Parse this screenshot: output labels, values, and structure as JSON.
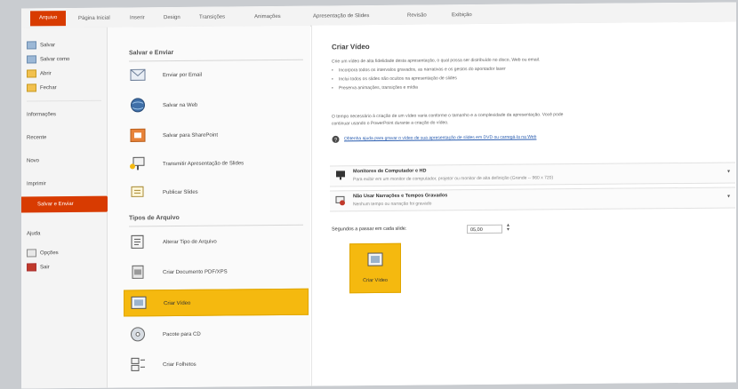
{
  "ribbon": {
    "tabs": [
      "Arquivo",
      "Página Inicial",
      "Inserir",
      "Design",
      "Transições",
      "Animações",
      "Apresentação de Slides",
      "Revisão",
      "Exibição"
    ]
  },
  "leftnav": {
    "items_top": [
      "Salvar",
      "Salvar como",
      "Abrir",
      "Fechar"
    ],
    "items_mid": [
      "Informações",
      "Recente",
      "Novo",
      "Imprimir"
    ],
    "active": "Salvar e Enviar",
    "items_bottom": [
      "Ajuda",
      "Opções",
      "Sair"
    ]
  },
  "middle": {
    "section1": "Salvar e Enviar",
    "send_items": [
      "Enviar por Email",
      "Salvar na Web",
      "Salvar para SharePoint",
      "Transmitir Apresentação de Slides",
      "Publicar Slides"
    ],
    "section2": "Tipos de Arquivo",
    "file_items": [
      "Alterar Tipo de Arquivo",
      "Criar Documento PDF/XPS",
      "Criar Vídeo",
      "Pacote para CD",
      "Criar Folhetos"
    ]
  },
  "right": {
    "title": "Criar Vídeo",
    "intro": "Crie um vídeo de alta fidelidade desta apresentação, o qual possa ser distribuído no disco, Web ou email.",
    "bullets": [
      "Incorpora todos os intervalos gravados, as narrativas e os gestos do apontador laser",
      "Inclui todos os slides não ocultos na apresentação de slides",
      "Preserva animações, transições e mídia"
    ],
    "time_note_1": "O tempo necessário à criação de um vídeo varia conforme o tamanho e a complexidade da apresentação. Você pode",
    "time_note_2": "continuar usando o PowerPoint durante a criação do vídeo.",
    "help_link": "Obtenha ajuda para gravar o vídeo de sua apresentação de slides em DVD ou carregá-la na Web",
    "quality_title": "Monitores de Computador e HD",
    "quality_desc": "Para exibir em um monitor de computador, projetor ou monitor de alta definição (Grande -- 960 x 720)",
    "narr_title": "Não Usar Narrações e Tempos Gravados",
    "narr_desc": "Nenhum tempo ou narração foi gravado",
    "seconds_label": "Segundos a passar em cada slide:",
    "seconds_value": "05,00",
    "create_button": "Criar Vídeo"
  }
}
